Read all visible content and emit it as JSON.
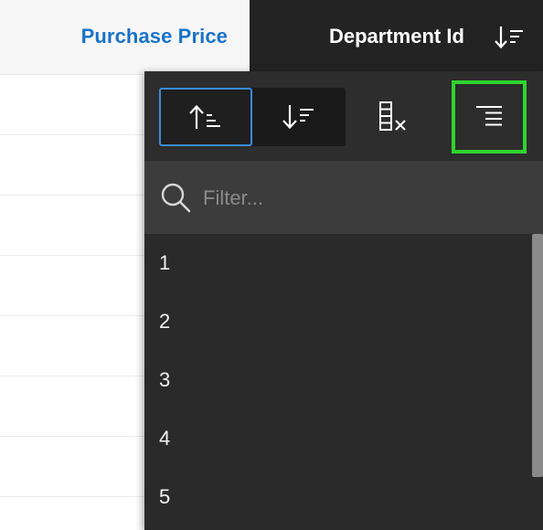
{
  "header": {
    "purchase_price_label": "Purchase Price",
    "department_id_label": "Department Id"
  },
  "popup": {
    "toolbar": {
      "sort_ascending": "sort-ascending-icon",
      "sort_descending": "sort-descending-icon",
      "clear_column": "clear-column-icon",
      "align_right": "align-right-icon"
    },
    "filter": {
      "placeholder": "Filter...",
      "value": ""
    },
    "values": [
      "1",
      "2",
      "3",
      "4",
      "5"
    ]
  },
  "colors": {
    "accent_blue": "#1a73c9",
    "selected_border": "#3a8be0",
    "highlight_green": "#2ed52e",
    "popup_bg": "#2a2a2a",
    "header_dark": "#232323"
  }
}
